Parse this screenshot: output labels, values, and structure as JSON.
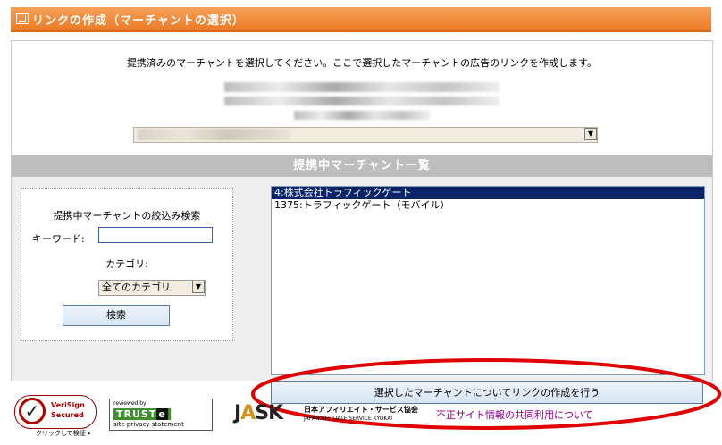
{
  "header": {
    "title": "リンクの作成（マーチャントの選択）"
  },
  "instruction": "提携済みのマーチャントを選択してください。ここで選択したマーチャントの広告のリンクを作成します。",
  "merchant_select": {
    "dropdown_icon": "▼"
  },
  "section": {
    "title": "提携中マーチャント一覧"
  },
  "search": {
    "title": "提携中マーチャントの絞込み検索",
    "keyword_label": "キーワード:",
    "keyword_value": "",
    "category_label": "カテゴリ:",
    "category_value": "全てのカテゴリ",
    "button_label": "検索"
  },
  "merchant_list": [
    {
      "label": "4:株式会社トラフィックゲート",
      "selected": true
    },
    {
      "label": "1375:トラフィックゲート（モバイル）",
      "selected": false
    }
  ],
  "create_button": "選択したマーチャントについてリンクの作成を行う",
  "footer": {
    "verisign_line1": "VeriSign",
    "verisign_line2": "Secured",
    "verisign_caption": "クリックして検証 ▸",
    "truste_reviewed": "reviewed by",
    "truste_logo": "TRUST",
    "truste_logo_e": "e",
    "truste_sub": "site privacy statement",
    "jask_logo_j": "J",
    "jask_logo_a": "A",
    "jask_logo_sk": "SK",
    "jask_jp": "日本アフィリエイト・サービス協会",
    "jask_en": "JAPAN AFFILIATE SERVICE KYOKAI",
    "fraud_link": "不正サイト情報の共同利用について"
  },
  "colors": {
    "header": "#ec7a24",
    "section_bar": "#bdbdbd",
    "list_selected": "#0a246a",
    "highlight_oval": "#e00000",
    "fraud_link": "#8b008b"
  }
}
